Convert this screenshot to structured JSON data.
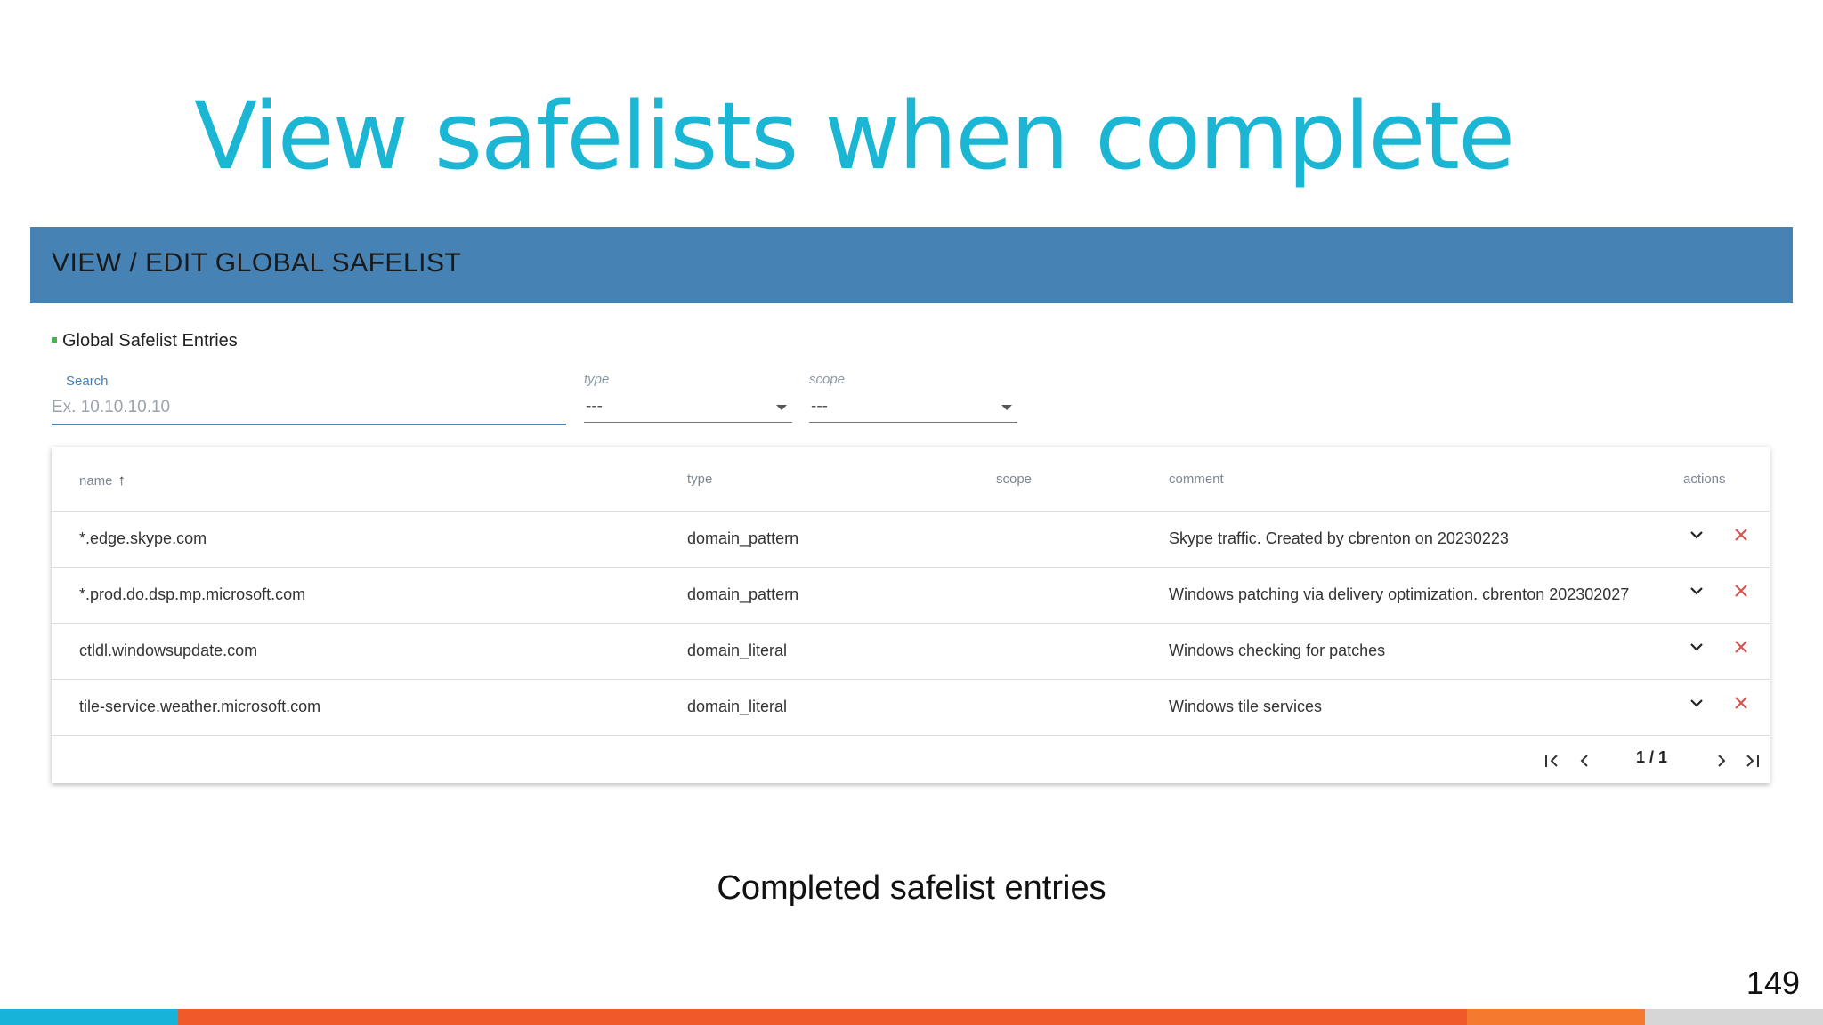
{
  "slide": {
    "title": "View safelists when complete",
    "caption": "Completed safelist entries",
    "page_number": "149"
  },
  "panel": {
    "header": "VIEW / EDIT GLOBAL SAFELIST",
    "section_label": "Global Safelist Entries"
  },
  "filters": {
    "search_label": "Search",
    "search_placeholder": "Ex. 10.10.10.10",
    "type_label": "type",
    "type_value": "---",
    "scope_label": "scope",
    "scope_value": "---"
  },
  "table": {
    "columns": {
      "name": "name",
      "type": "type",
      "scope": "scope",
      "comment": "comment",
      "actions": "actions"
    },
    "rows": [
      {
        "name": "*.edge.skype.com",
        "type": "domain_pattern",
        "scope": "",
        "comment": "Skype traffic. Created by cbrenton on 20230223"
      },
      {
        "name": "*.prod.do.dsp.mp.microsoft.com",
        "type": "domain_pattern",
        "scope": "",
        "comment": "Windows patching via delivery optimization. cbrenton 202302027"
      },
      {
        "name": "ctldl.windowsupdate.com",
        "type": "domain_literal",
        "scope": "",
        "comment": "Windows checking for patches"
      },
      {
        "name": "tile-service.weather.microsoft.com",
        "type": "domain_literal",
        "scope": "",
        "comment": "Windows tile services"
      }
    ],
    "pagination": "1 / 1"
  },
  "colors": {
    "title": "#1bb6d4",
    "header_bg": "#4682b4",
    "delete_icon": "#d9534f",
    "bar_cyan": "#17b3d8",
    "bar_orange": "#f05a2a",
    "bar_orange_light": "#f47a2f",
    "bar_gray": "#d6d6d6"
  }
}
